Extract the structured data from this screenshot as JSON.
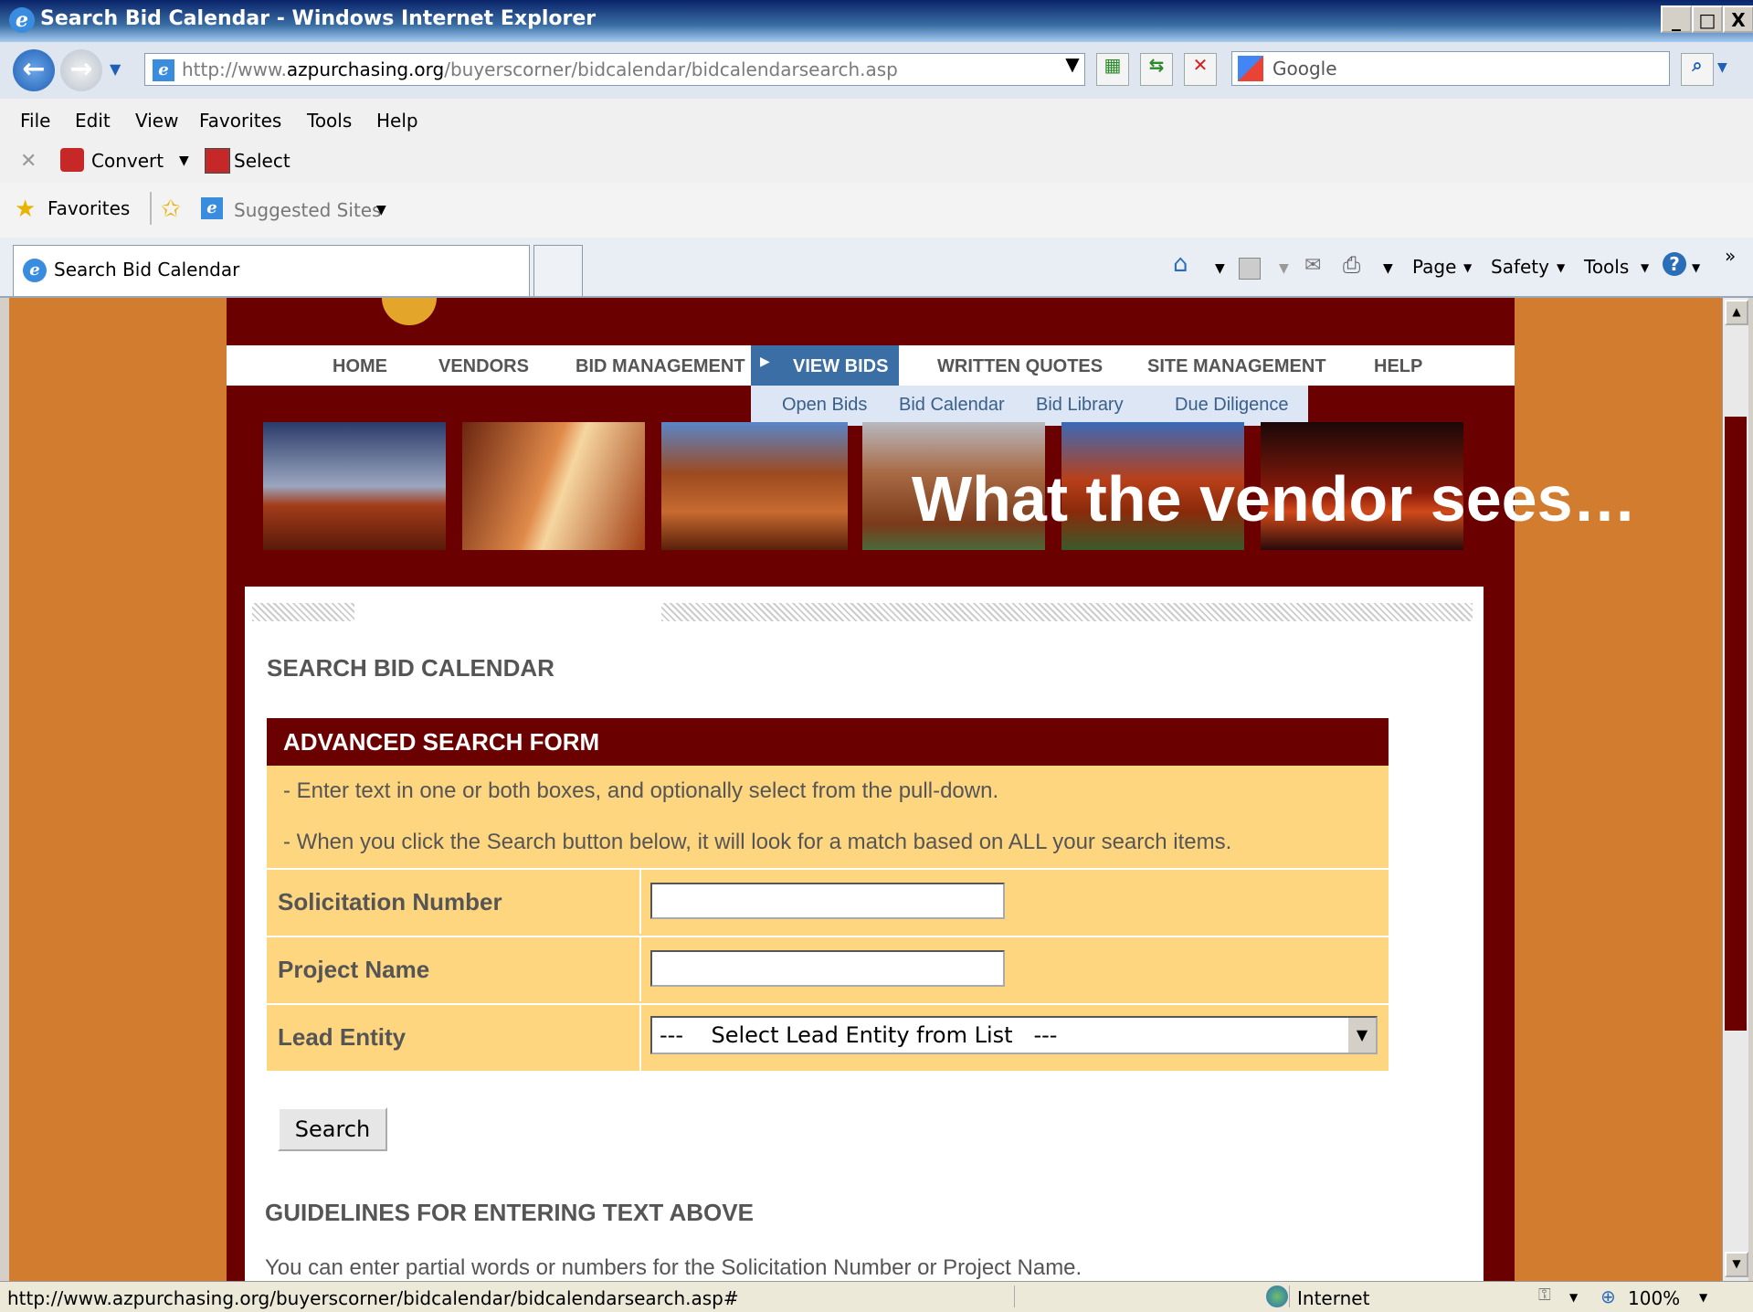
{
  "window": {
    "title": "Search Bid Calendar - Windows Internet Explorer",
    "min": "_",
    "max": "□",
    "close": "X"
  },
  "address": {
    "prefix": "http://www.",
    "domain": "azpurchasing.org",
    "path": "/buyerscorner/bidcalendar/bidcalendarsearch.asp",
    "search_placeholder": "Google"
  },
  "menu": [
    "File",
    "Edit",
    "View",
    "Favorites",
    "Tools",
    "Help"
  ],
  "commands": {
    "convert": "Convert",
    "select": "Select"
  },
  "favorites": {
    "label": "Favorites",
    "suggested": "Suggested Sites"
  },
  "tab": {
    "title": "Search Bid Calendar"
  },
  "toolbar": {
    "page": "Page",
    "safety": "Safety",
    "tools": "Tools"
  },
  "site_nav": [
    "HOME",
    "VENDORS",
    "BID MANAGEMENT",
    "VIEW BIDS",
    "WRITTEN QUOTES",
    "SITE MANAGEMENT",
    "HELP"
  ],
  "site_subnav": [
    "Open Bids",
    "Bid Calendar",
    "Bid Library",
    "Due Diligence"
  ],
  "overlay_caption": "What the vendor sees…",
  "content": {
    "title": "SEARCH BID CALENDAR",
    "form_title": "ADVANCED SEARCH FORM",
    "instructions": [
      "- Enter text in one or both boxes, and optionally select from the pull-down.",
      "- When you click the Search button below, it will look for a match based on ALL your search items."
    ],
    "fields": {
      "solicitation": "Solicitation Number",
      "project": "Project Name",
      "lead": "Lead Entity",
      "lead_select": "---    Select Lead Entity from List   ---"
    },
    "search_button": "Search",
    "guidelines_title": "GUIDELINES FOR ENTERING TEXT ABOVE",
    "guidelines_text": "You can enter partial words or numbers for the Solicitation Number or Project Name."
  },
  "status": {
    "url": "http://www.azpurchasing.org/buyerscorner/bidcalendar/bidcalendarsearch.asp#",
    "zone": "Internet",
    "zoom": "100%"
  },
  "colors": {
    "maroon": "#6b0000",
    "orange": "#d27c2f",
    "form_bg": "#ffd680",
    "nav_active": "#3a6ea5"
  }
}
